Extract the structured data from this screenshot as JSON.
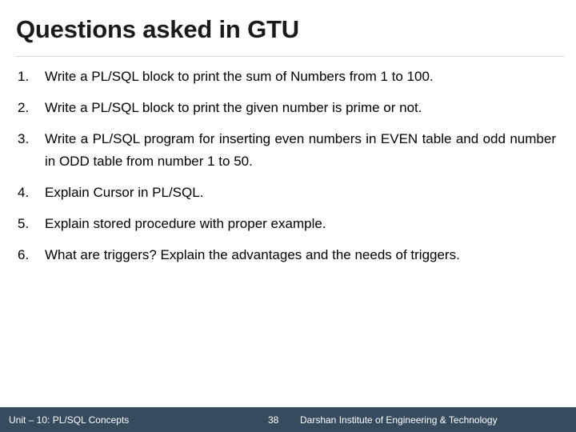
{
  "slide": {
    "title": "Questions asked in GTU",
    "questions": [
      {
        "number": "1.",
        "text": "Write a PL/SQL block to print the sum of Numbers from 1 to 100."
      },
      {
        "number": "2.",
        "text": "Write a PL/SQL block to print the given number is prime or not."
      },
      {
        "number": "3.",
        "text": "Write a PL/SQL program for inserting even numbers in EVEN table and odd number in ODD table from number 1 to 50."
      },
      {
        "number": "4.",
        "text": "Explain Cursor in PL/SQL."
      },
      {
        "number": "5.",
        "text": "Explain stored procedure with proper example."
      },
      {
        "number": "6.",
        "text": "What are triggers? Explain the advantages and the needs of triggers."
      }
    ]
  },
  "footer": {
    "unit": "Unit – 10: PL/SQL Concepts",
    "page_number": "38",
    "organization": "Darshan Institute of Engineering & Technology",
    "background_color": "#374b5e",
    "text_color": "#ffffff"
  },
  "theme": {
    "title_color": "#1a1a1a",
    "body_text_color": "#000000",
    "divider_color": "#d9d9dd",
    "slide_background": "#ffffff"
  }
}
